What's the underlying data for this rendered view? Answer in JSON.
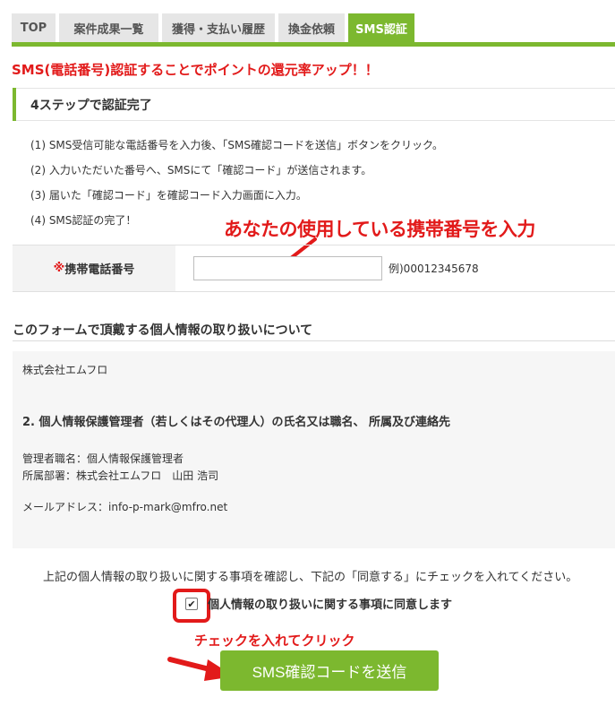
{
  "tabs": [
    {
      "label": "TOP",
      "active": false
    },
    {
      "label": "案件成果一覧",
      "active": false
    },
    {
      "label": "獲得・支払い履歴",
      "active": false
    },
    {
      "label": "換金依頼",
      "active": false
    },
    {
      "label": "SMS認証",
      "active": true
    }
  ],
  "headline": "SMS(電話番号)認証することでポイントの還元率アップ！！",
  "step_title": "4ステップで認証完了",
  "steps": [
    "(1) SMS受信可能な電話番号を入力後、「SMS確認コードを送信」ボタンをクリック。",
    "(2) 入力いただいた番号へ、SMSにて「確認コード」が送信されます。",
    "(3) 届いた「確認コード」を確認コード入力画面に入力。",
    "(4) SMS認証の完了！"
  ],
  "phone": {
    "required_mark": "※",
    "label": "携帯電話番号",
    "value": "",
    "example": "例)00012345678"
  },
  "annotations": {
    "input_hint": "あなたの使用している携帯番号を入力",
    "check_hint": "チェックを入れてクリック"
  },
  "privacy": {
    "heading": "このフォームで頂戴する個人情報の取り扱いについて",
    "company": "株式会社エムフロ",
    "section_title": "2. 個人情報保護管理者（若しくはその代理人）の氏名又は職名、 所属及び連絡先",
    "manager_title": "管理者職名：個人情報保護管理者",
    "department": "所属部署：株式会社エムフロ　山田 浩司",
    "email": "メールアドレス：info-p-mark@mfro.net"
  },
  "consent": {
    "note": "上記の個人情報の取り扱いに関する事項を確認し、下記の「同意する」にチェックを入れてください。",
    "checkbox_label": "個人情報の取り扱いに関する事項に同意します",
    "checked": true,
    "check_glyph": "✔"
  },
  "submit_label": "SMS確認コードを送信",
  "colors": {
    "accent_green": "#7cb82f",
    "alert_red": "#e21a1a"
  }
}
